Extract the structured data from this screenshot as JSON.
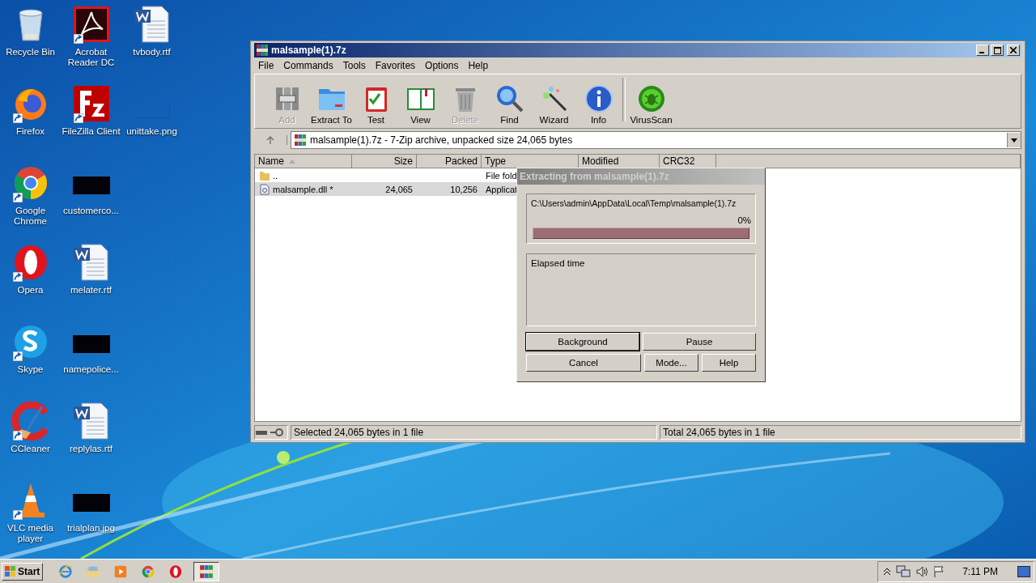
{
  "desktop": {
    "columns": [
      [
        {
          "label": "Recycle Bin",
          "kind": "recycle-bin",
          "shortcut": false
        },
        {
          "label": "Firefox",
          "kind": "firefox",
          "shortcut": true
        },
        {
          "label": "Google Chrome",
          "kind": "chrome",
          "shortcut": true
        },
        {
          "label": "Opera",
          "kind": "opera",
          "shortcut": true
        },
        {
          "label": "Skype",
          "kind": "skype",
          "shortcut": true
        },
        {
          "label": "CCleaner",
          "kind": "ccleaner",
          "shortcut": true
        },
        {
          "label": "VLC media player",
          "kind": "vlc",
          "shortcut": true
        }
      ],
      [
        {
          "label": "Acrobat Reader DC",
          "kind": "acrobat",
          "shortcut": true
        },
        {
          "label": "FileZilla Client",
          "kind": "filezilla",
          "shortcut": true
        },
        {
          "label": "customerco...",
          "kind": "dark-thumb",
          "shortcut": false
        },
        {
          "label": "melater.rtf",
          "kind": "word",
          "shortcut": false
        },
        {
          "label": "namepolice...",
          "kind": "dark-thumb",
          "shortcut": false
        },
        {
          "label": "replylas.rtf",
          "kind": "word",
          "shortcut": false
        },
        {
          "label": "trialplan.jpg",
          "kind": "dark-thumb",
          "shortcut": false
        }
      ],
      [
        {
          "label": "tvbody.rtf",
          "kind": "word",
          "shortcut": false
        },
        {
          "label": "unittake.png",
          "kind": "blank-thumb",
          "shortcut": false
        }
      ]
    ]
  },
  "window": {
    "title": "malsample(1).7z",
    "menu": [
      "File",
      "Commands",
      "Tools",
      "Favorites",
      "Options",
      "Help"
    ],
    "toolbar": [
      {
        "label": "Add",
        "kind": "add",
        "disabled": true
      },
      {
        "label": "Extract To",
        "kind": "extract",
        "disabled": false
      },
      {
        "label": "Test",
        "kind": "test",
        "disabled": false
      },
      {
        "label": "View",
        "kind": "view",
        "disabled": false
      },
      {
        "label": "Delete",
        "kind": "delete",
        "disabled": true
      },
      {
        "label": "Find",
        "kind": "find",
        "disabled": false
      },
      {
        "label": "Wizard",
        "kind": "wizard",
        "disabled": false
      },
      {
        "label": "Info",
        "kind": "info",
        "disabled": false
      },
      {
        "label": "VirusScan",
        "kind": "virusscan",
        "disabled": false
      }
    ],
    "address": "malsample(1).7z - 7-Zip archive, unpacked size 24,065 bytes",
    "columns": [
      "Name",
      "Size",
      "Packed",
      "Type",
      "Modified",
      "CRC32"
    ],
    "rows": [
      {
        "kind": "folder",
        "name": "..",
        "size": "",
        "packed": "",
        "type": "File fold",
        "selected": false
      },
      {
        "kind": "file",
        "name": "malsample.dll *",
        "size": "24,065",
        "packed": "10,256",
        "type": "Applicat",
        "selected": true
      }
    ],
    "status_left": "Selected 24,065 bytes in 1 file",
    "status_right": "Total 24,065 bytes in 1 file"
  },
  "dialog": {
    "title": "Extracting from malsample(1).7z",
    "path": "C:\\Users\\admin\\AppData\\Local\\Temp\\malsample(1).7z",
    "percent": "0%",
    "level": 0,
    "elapsed_label": "Elapsed time",
    "button_rows": [
      [
        {
          "label": "Background",
          "default": true
        },
        {
          "label": "Pause",
          "default": false
        }
      ],
      [
        {
          "label": "Cancel",
          "default": false
        },
        {
          "label": "Mode...",
          "default": false
        },
        {
          "label": "Help",
          "default": false
        }
      ]
    ]
  },
  "taskbar": {
    "start": "Start",
    "apps": [
      {
        "kind": "ie",
        "selected": false
      },
      {
        "kind": "explorer",
        "selected": false
      },
      {
        "kind": "media",
        "selected": false
      },
      {
        "kind": "chrome",
        "selected": false
      },
      {
        "kind": "opera",
        "selected": false
      },
      {
        "kind": "winrar",
        "selected": true
      }
    ],
    "clock": "7:11 PM"
  }
}
